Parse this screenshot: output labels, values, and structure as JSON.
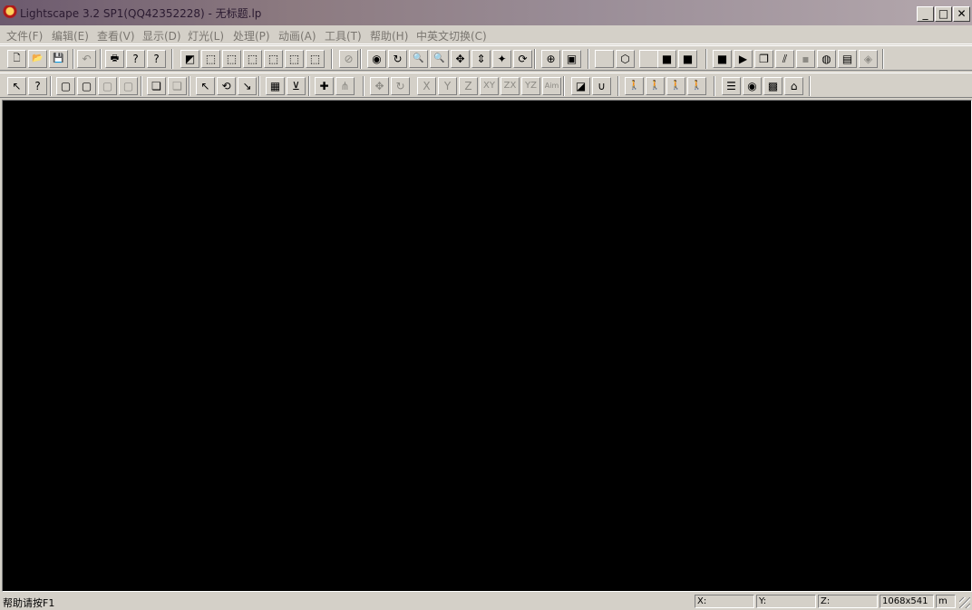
{
  "window": {
    "title": "Lightscape 3.2 SP1(QQ42352228) - 无标题.lp",
    "controls": [
      "_",
      "□",
      "✕"
    ]
  },
  "menu": [
    "文件(F)",
    "编辑(E)",
    "查看(V)",
    "显示(D)",
    "灯光(L)",
    "处理(P)",
    "动画(A)",
    "工具(T)",
    "帮助(H)",
    "中英文切换(C)"
  ],
  "toolbar1": [
    {
      "name": "new-icon",
      "glyph": "🗋"
    },
    {
      "name": "open-icon",
      "glyph": "📂"
    },
    {
      "name": "save-icon",
      "glyph": "💾"
    },
    {
      "name": "undo-icon",
      "glyph": "↶",
      "disabled": true
    },
    {
      "name": "print-icon",
      "glyph": "🖶"
    },
    {
      "name": "help-icon",
      "glyph": "?"
    },
    {
      "name": "context-help-icon",
      "glyph": "?"
    },
    {
      "name": "view-perspective-icon",
      "glyph": "◩"
    },
    {
      "name": "view-cube-1-icon",
      "glyph": "⬚"
    },
    {
      "name": "view-cube-2-icon",
      "glyph": "⬚"
    },
    {
      "name": "view-cube-3-icon",
      "glyph": "⬚"
    },
    {
      "name": "view-cube-4-icon",
      "glyph": "⬚"
    },
    {
      "name": "view-cube-5-icon",
      "glyph": "⬚"
    },
    {
      "name": "view-cube-6-icon",
      "glyph": "⬚"
    },
    {
      "name": "zoom-previous-icon",
      "glyph": "⊘",
      "disabled": true
    },
    {
      "name": "orbit-icon",
      "glyph": "◉"
    },
    {
      "name": "rotate-view-icon",
      "glyph": "↻"
    },
    {
      "name": "zoom-in-icon",
      "glyph": "🔍"
    },
    {
      "name": "zoom-out-icon",
      "glyph": "🔍"
    },
    {
      "name": "pan-icon",
      "glyph": "✥"
    },
    {
      "name": "dolly-icon",
      "glyph": "⇕"
    },
    {
      "name": "fly-icon",
      "glyph": "✦"
    },
    {
      "name": "refresh-icon",
      "glyph": "⟳"
    },
    {
      "name": "zoom-extents-icon",
      "glyph": "⊕"
    },
    {
      "name": "camera-icon",
      "glyph": "▣"
    },
    {
      "name": "blank-display-icon",
      "glyph": ""
    },
    {
      "name": "wireframe-icon",
      "glyph": "⬡"
    },
    {
      "name": "blank-display-2-icon",
      "glyph": ""
    },
    {
      "name": "solid-cube-icon",
      "glyph": "■"
    },
    {
      "name": "shaded-cube-icon",
      "glyph": "■"
    },
    {
      "name": "render-object-icon",
      "glyph": "■"
    },
    {
      "name": "render-flip-icon",
      "glyph": "▶"
    },
    {
      "name": "layer-copy-icon",
      "glyph": "❐"
    },
    {
      "name": "texture-icon",
      "glyph": "⫽"
    },
    {
      "name": "grey-square-icon",
      "glyph": "▪",
      "disabled": true
    },
    {
      "name": "globe-icon",
      "glyph": "◍"
    },
    {
      "name": "frame-icon",
      "glyph": "▤"
    },
    {
      "name": "render-disabled-icon",
      "glyph": "◈",
      "disabled": true
    }
  ],
  "toolbar2": [
    {
      "name": "select-arrow-icon",
      "glyph": "↖"
    },
    {
      "name": "select-help-icon",
      "glyph": "?"
    },
    {
      "name": "select-box-icon",
      "glyph": "▢"
    },
    {
      "name": "select-zoom-icon",
      "glyph": "▢"
    },
    {
      "name": "select-x-icon",
      "glyph": "▢",
      "disabled": true
    },
    {
      "name": "select-x2-icon",
      "glyph": "▢",
      "disabled": true
    },
    {
      "name": "copy-page-icon",
      "glyph": "❏"
    },
    {
      "name": "copy-page-disabled-icon",
      "glyph": "❏",
      "disabled": true
    },
    {
      "name": "select-pointer-icon",
      "glyph": "↖"
    },
    {
      "name": "transform-icon",
      "glyph": "⟲"
    },
    {
      "name": "pick-icon",
      "glyph": "↘"
    },
    {
      "name": "edit-table-icon",
      "glyph": "▦"
    },
    {
      "name": "filter-icon",
      "glyph": "⊻"
    },
    {
      "name": "add-light-icon",
      "glyph": "✚"
    },
    {
      "name": "node-icon",
      "glyph": "⋔",
      "disabled": true
    },
    {
      "name": "move-icon",
      "glyph": "✥",
      "disabled": true
    },
    {
      "name": "rotate-icon",
      "glyph": "↻",
      "disabled": true
    },
    {
      "name": "axis-x-button",
      "glyph": "X",
      "disabled": true
    },
    {
      "name": "axis-y-button",
      "glyph": "Y",
      "disabled": true
    },
    {
      "name": "axis-z-button",
      "glyph": "Z",
      "disabled": true
    },
    {
      "name": "axis-xy-button",
      "glyph": "XY",
      "disabled": true
    },
    {
      "name": "axis-zx-button",
      "glyph": "ZX",
      "disabled": true
    },
    {
      "name": "axis-yz-button",
      "glyph": "YZ",
      "disabled": true
    },
    {
      "name": "axis-aim-button",
      "glyph": "Aim",
      "disabled": true
    },
    {
      "name": "tag-icon",
      "glyph": "◪"
    },
    {
      "name": "magnet-icon",
      "glyph": "∪"
    },
    {
      "name": "walk-1-icon",
      "glyph": "🚶"
    },
    {
      "name": "walk-2-icon",
      "glyph": "🚶"
    },
    {
      "name": "walk-3-icon",
      "glyph": "🚶",
      "disabled": true
    },
    {
      "name": "walk-4-icon",
      "glyph": "🚶",
      "disabled": true
    },
    {
      "name": "layers-icon",
      "glyph": "☰"
    },
    {
      "name": "material-icon",
      "glyph": "◉"
    },
    {
      "name": "block-icon",
      "glyph": "▩"
    },
    {
      "name": "lamp-icon",
      "glyph": "⌂"
    }
  ],
  "status": {
    "help": "帮助请按F1",
    "x_label": "X:",
    "y_label": "Y:",
    "z_label": "Z:",
    "size": "1068x541",
    "unit": "m"
  }
}
